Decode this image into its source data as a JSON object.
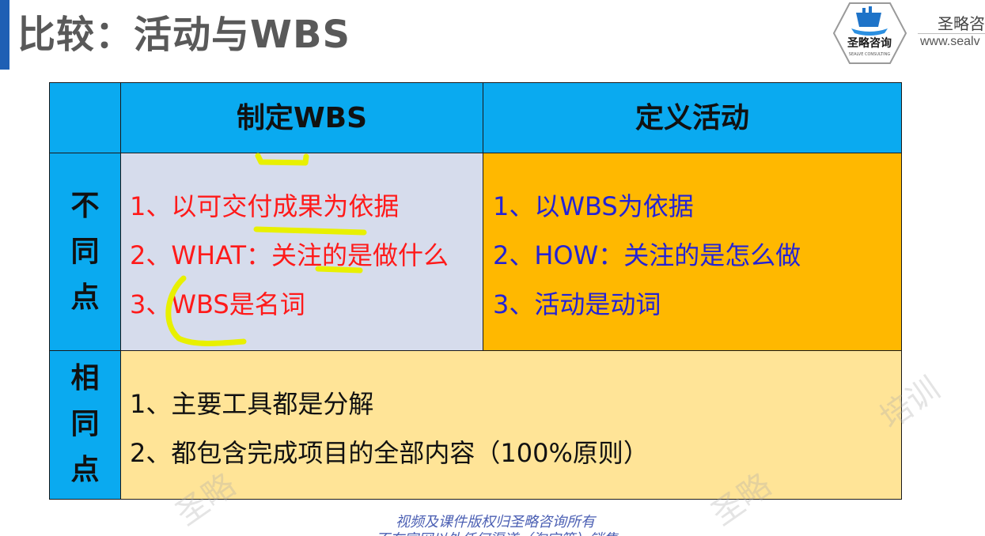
{
  "slide": {
    "title": "比较：活动与WBS"
  },
  "brand": {
    "logo_text": "圣略咨询",
    "logo_subtext": "SEALVE CONSULTING",
    "company_name_visible": "圣略咨",
    "url_visible": "www.sealv"
  },
  "table": {
    "headers": {
      "wbs": "制定WBS",
      "activity": "定义活动"
    },
    "rows": {
      "differences": {
        "label": [
          "不",
          "同",
          "点"
        ],
        "wbs_items": [
          "1、以可交付成果为依据",
          "2、WHAT：关注的是做什么",
          "3、WBS是名词"
        ],
        "activity_items": [
          "1、以WBS为依据",
          "2、HOW：关注的是怎么做",
          "3、活动是动词"
        ]
      },
      "similarities": {
        "label": [
          "相",
          "同",
          "点"
        ],
        "items": [
          "1、主要工具都是分解",
          "2、都包含完成项目的全部内容（100%原则）"
        ]
      }
    }
  },
  "footer": {
    "copyright_line1": "视频及课件版权归圣略咨询所有",
    "copyright_line2": "不在官网以外任何渠道（淘宝等）销售"
  },
  "watermarks": {
    "w1": "圣略",
    "w2": "圣略",
    "w3": "培训"
  },
  "colors": {
    "header_blue": "#0aaaf0",
    "wbs_cell": "#d6dcec",
    "activity_cell": "#ffb800",
    "same_cell": "#ffe497",
    "wbs_text": "#ff1a1a",
    "activity_text": "#2323d6",
    "highlight": "#e8f000",
    "title_gray": "#595959"
  }
}
